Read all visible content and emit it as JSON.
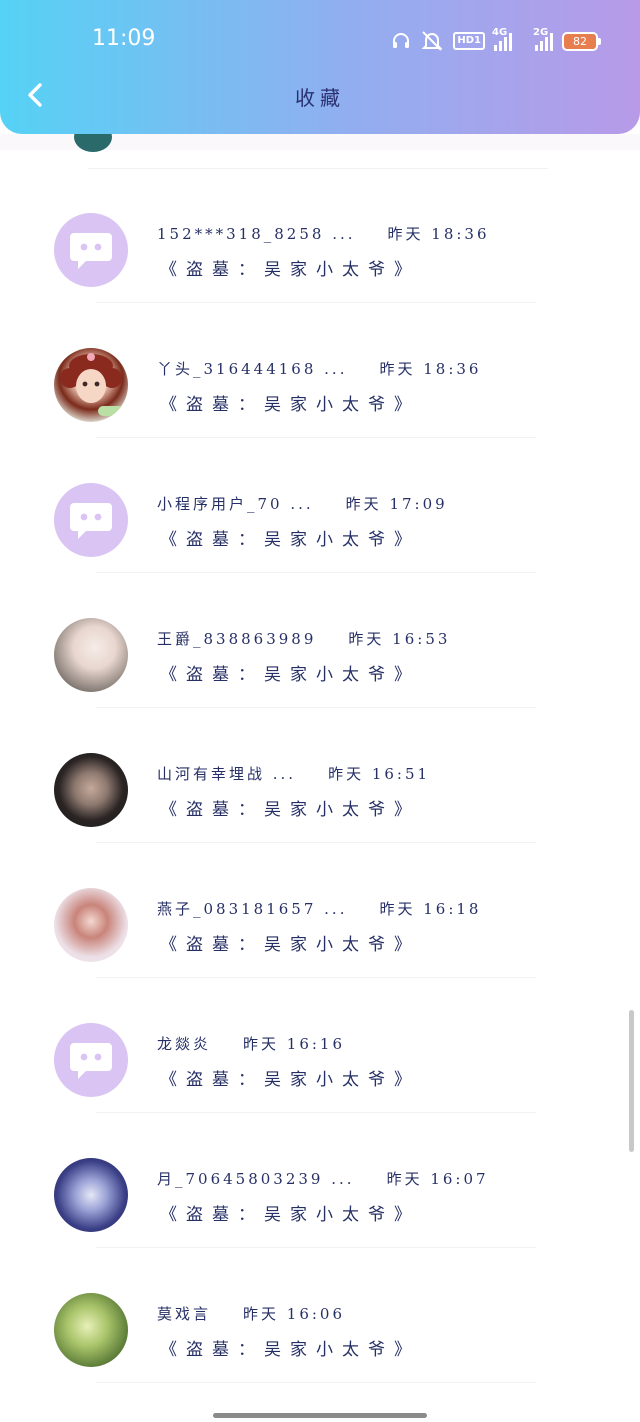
{
  "status_bar": {
    "time": "11:09",
    "hd": "HD1",
    "net1": "4G",
    "net2": "2G",
    "battery": "82"
  },
  "header": {
    "title": "收藏"
  },
  "items": [
    {
      "name": "152***318_8258 ...",
      "time": "昨天 18:36",
      "message": "《盗墓：吴家小太爷》",
      "avatar": "default-avatar"
    },
    {
      "name": "丫头_316444168 ...",
      "time": "昨天 18:36",
      "message": "《盗墓：吴家小太爷》",
      "avatar": "anime-girl-avatar"
    },
    {
      "name": "小程序用户_70 ...",
      "time": "昨天 17:09",
      "message": "《盗墓：吴家小太爷》",
      "avatar": "default-avatar"
    },
    {
      "name": "王爵_838863989",
      "time": "昨天 16:53",
      "message": "《盗墓：吴家小太爷》",
      "avatar": "photo-avatar"
    },
    {
      "name": "山河有幸埋战 ...",
      "time": "昨天 16:51",
      "message": "《盗墓：吴家小太爷》",
      "avatar": "photo-avatar"
    },
    {
      "name": "燕子_083181657 ...",
      "time": "昨天 16:18",
      "message": "《盗墓：吴家小太爷》",
      "avatar": "photo-avatar"
    },
    {
      "name": "龙燚炎",
      "time": "昨天 16:16",
      "message": "《盗墓：吴家小太爷》",
      "avatar": "default-avatar"
    },
    {
      "name": "月_70645803239 ...",
      "time": "昨天 16:07",
      "message": "《盗墓：吴家小太爷》",
      "avatar": "photo-avatar"
    },
    {
      "name": "莫戏言",
      "time": "昨天 16:06",
      "message": "《盗墓：吴家小太爷》",
      "avatar": "photo-avatar"
    }
  ]
}
